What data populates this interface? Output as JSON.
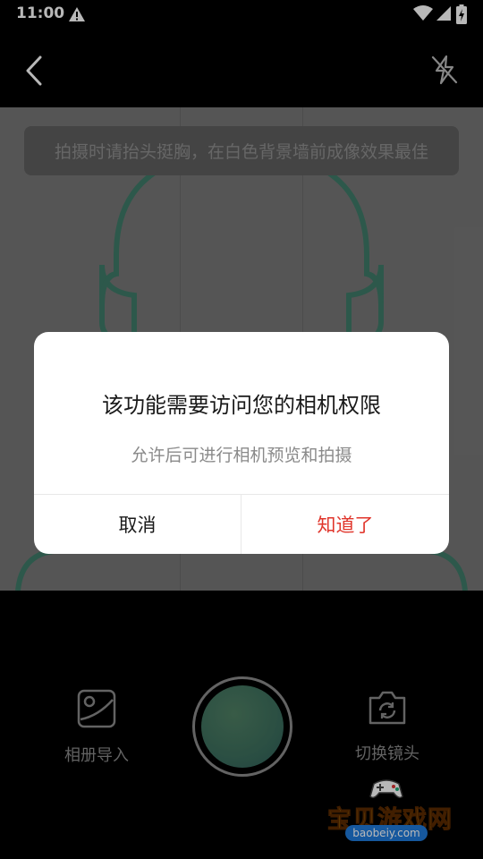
{
  "status_bar": {
    "time": "11:00"
  },
  "camera": {
    "tip": "拍摄时请抬头挺胸，在白色背景墙前成像效果最佳"
  },
  "bottom": {
    "album_label": "相册导入",
    "switch_label": "切换镜头"
  },
  "dialog": {
    "title": "该功能需要访问您的相机权限",
    "message": "允许后可进行相机预览和拍摄",
    "cancel_label": "取消",
    "ok_label": "知道了"
  },
  "watermark": {
    "title": "宝贝游戏网",
    "domain": "baobeiy.com"
  },
  "colors": {
    "accent_red": "#e0352b",
    "outline_green": "#3f7b68",
    "shutter_green": "#3c6e5d"
  },
  "icons": [
    "warning-icon",
    "wifi-icon",
    "signal-icon",
    "battery-icon",
    "back-icon",
    "flash-off-icon",
    "album-icon",
    "switch-camera-icon"
  ]
}
